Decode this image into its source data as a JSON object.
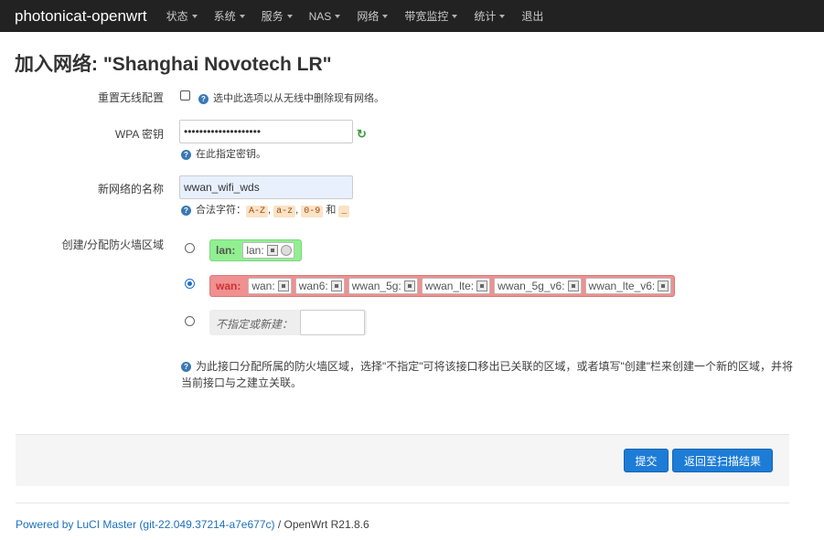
{
  "navbar": {
    "brand": "photonicat-openwrt",
    "items": [
      {
        "label": "状态"
      },
      {
        "label": "系统"
      },
      {
        "label": "服务"
      },
      {
        "label": "NAS"
      },
      {
        "label": "网络"
      },
      {
        "label": "带宽监控"
      },
      {
        "label": "统计"
      },
      {
        "label": "退出"
      }
    ]
  },
  "page": {
    "title": "加入网络: \"Shanghai Novotech LR\""
  },
  "form": {
    "reset_wireless": {
      "label": "重置无线配置",
      "checked": false,
      "help": "选中此选项以从无线中删除现有网络。"
    },
    "wpa_key": {
      "label": "WPA 密钥",
      "value": "••••••••••••••••••••",
      "help": "在此指定密钥。"
    },
    "network_name": {
      "label": "新网络的名称",
      "value": "wwan_wifi_wds",
      "help_prefix": "合法字符：",
      "codes": [
        "A-Z",
        "a-z",
        "0-9",
        "_"
      ],
      "sep": ",",
      "and": "和"
    },
    "firewall_zone": {
      "label": "创建/分配防火墙区域",
      "zones": [
        {
          "name": "lan:",
          "ifaces": [
            "lan:"
          ],
          "checked": false,
          "color": "#90f090"
        },
        {
          "name": "wan:",
          "ifaces": [
            "wan:",
            "wan6:",
            "wwan_5g:",
            "wwan_lte:",
            "wwan_5g_v6:",
            "wwan_lte_v6:"
          ],
          "checked": true,
          "color": "#f09090"
        }
      ],
      "unspecified_label": "不指定或新建：",
      "unspecified_value": "",
      "help": "为此接口分配所属的防火墙区域，选择\"不指定\"可将该接口移出已关联的区域，或者填写\"创建\"栏来创建一个新的区域，并将当前接口与之建立关联。"
    }
  },
  "actions": {
    "submit": "提交",
    "back": "返回至扫描结果"
  },
  "footer": {
    "link": "Powered by LuCI Master (git-22.049.37214-a7e677c)",
    "suffix": " / OpenWrt R21.8.6"
  },
  "colors": {
    "navbar_bg": "#222222",
    "accent": "#1d7cd6",
    "lan_zone": "#90f090",
    "wan_zone": "#f09090"
  }
}
